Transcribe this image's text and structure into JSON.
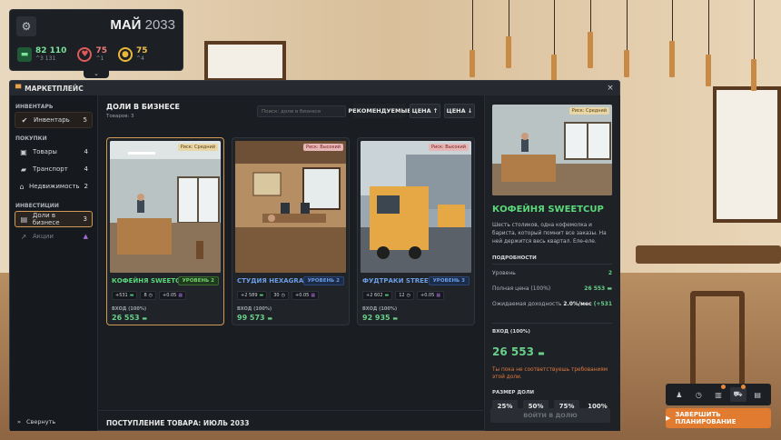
{
  "hud": {
    "month": "МАЙ",
    "year": "2033",
    "money": "82 110",
    "money_delta": "^3 131",
    "mood": "75",
    "mood_delta": "^1",
    "energy": "75",
    "energy_delta": "^4"
  },
  "modal": {
    "title": "МАРКЕТПЛЕЙС",
    "close_icon": "×"
  },
  "sidebar": {
    "section_inventory": "ИНВЕНТАРЬ",
    "section_purchases": "ПОКУПКИ",
    "section_investments": "ИНВЕСТИЦИИ",
    "items": [
      {
        "label": "Инвентарь",
        "count": "5"
      },
      {
        "label": "Товары",
        "count": "4"
      },
      {
        "label": "Транспорт",
        "count": "4"
      },
      {
        "label": "Недвижимость",
        "count": "2"
      },
      {
        "label": "Доли в бизнесе",
        "count": "3"
      },
      {
        "label": "Акции",
        "count": ""
      }
    ],
    "collapse_label": "Свернуть"
  },
  "content": {
    "title": "ДОЛИ В БИЗНЕСЕ",
    "subtitle": "Товаров: 3",
    "search_placeholder": "Поиск: доли в бизнесе",
    "sort_recommended": "РЕКОМЕНДУЕМЫЕ",
    "sort_price_up": "ЦЕНА ↑",
    "sort_price_down": "ЦЕНА ↓",
    "footer": "ПОСТУПЛЕНИЕ ТОВАРА: ИЮЛЬ 2033",
    "entry_label": "ВХОД (100%)",
    "cards": [
      {
        "name": "КОФЕЙНЯ SWEETCUP",
        "risk": "Риск: Средний",
        "level": "УРОВЕНЬ 2",
        "chip1": "+531",
        "chip2": "8",
        "chip3": "+0.05",
        "entry": "26 553"
      },
      {
        "name": "СТУДИЯ HEXAGRAM",
        "risk": "Риск: Высокий",
        "level": "УРОВЕНЬ 2",
        "chip1": "+2 589",
        "chip2": "30",
        "chip3": "+0.05",
        "entry": "99 573"
      },
      {
        "name": "ФУДТРАКИ STREETBITES",
        "risk": "Риск: Высокий",
        "level": "УРОВЕНЬ 3",
        "chip1": "+2 602",
        "chip2": "12",
        "chip3": "+0.05",
        "entry": "92 935"
      }
    ]
  },
  "detail": {
    "risk": "Риск: Средний",
    "name": "КОФЕЙНЯ SWEETCUP",
    "description": "Шесть столиков, одна кофемолка и бариста, который помнит все заказы. На ней держится весь квартал. Еле-еле.",
    "details_title": "ПОДРОБНОСТИ",
    "level_label": "Уровень",
    "level_value": "2",
    "full_price_label": "Полная цена (100%)",
    "full_price_value": "26 553",
    "expected_yield_label": "Ожидаемая доходность",
    "expected_yield_value": "2.0%/мес",
    "expected_yield_extra": "(+531",
    "entry_label": "ВХОД (100%)",
    "entry_value": "26 553",
    "warning": "Ты пока не соответствуешь требованиям этой доли.",
    "share_title": "РАЗМЕР ДОЛИ",
    "shares": [
      "25%",
      "50%",
      "75%",
      "100%"
    ],
    "enter_button": "ВОЙТИ В ДОЛЮ"
  },
  "toolbar": {
    "finish_label": "ЗАВЕРШИТЬ ПЛАНИРОВАНИЕ"
  },
  "colors": {
    "accent": "#d19a55",
    "money_green": "#68d08a",
    "finish_orange": "#e07b2f"
  }
}
